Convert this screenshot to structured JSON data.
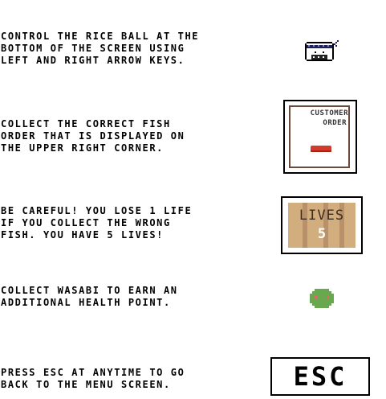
{
  "instructions": [
    {
      "id": "controls",
      "text": "CONTROL THE RICE BALL AT THE\nBOTTOM OF THE SCREEN USING\nLEFT AND RIGHT ARROW KEYS.",
      "icon": "rice-ball-icon"
    },
    {
      "id": "collect-order",
      "text": "COLLECT THE CORRECT FISH\nORDER THAT IS DISPLAYED ON\nTHE UPPER RIGHT CORNER.",
      "icon": "customer-order-card"
    },
    {
      "id": "lives",
      "text": "BE CAREFUL! YOU LOSE 1 LIFE\nIF YOU COLLECT THE WRONG\nFISH. YOU HAVE 5 LIVES!",
      "icon": "lives-card"
    },
    {
      "id": "wasabi",
      "text": "COLLECT WASABI TO EARN AN\nADDITIONAL HEALTH POINT.",
      "icon": "wasabi-icon"
    },
    {
      "id": "escape",
      "text": "PRESS ESC AT ANYTIME TO GO\nBACK TO THE MENU SCREEN.",
      "icon": "esc-key"
    }
  ],
  "order_card": {
    "line1": "CUSTOMER",
    "line2": "ORDER",
    "fish_color": "#d23a2c"
  },
  "lives_card": {
    "label": "LIVES",
    "count": "5"
  },
  "esc_key": {
    "label": "ESC"
  },
  "colors": {
    "background": "#ffffff",
    "text": "#000000",
    "wood": "#d2ad7e",
    "wasabi": "#6aa84f",
    "wasabi_eyes": "#e06666",
    "ninja_band": "#1f1f5c"
  }
}
